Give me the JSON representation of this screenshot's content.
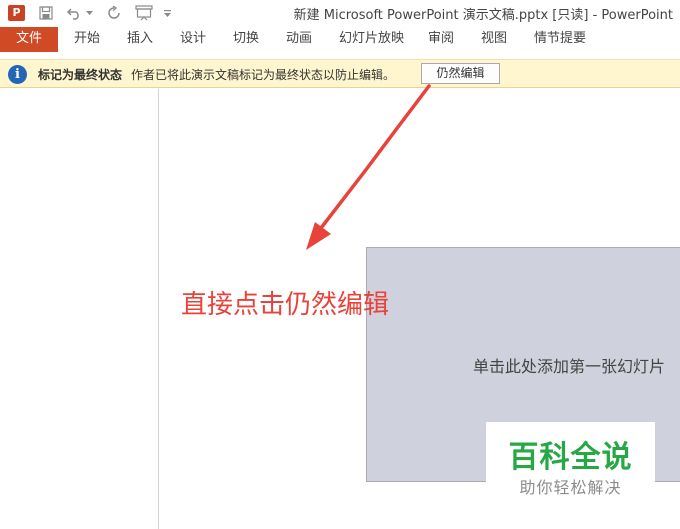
{
  "app": {
    "icon_letter": "P",
    "window_title": "新建 Microsoft PowerPoint 演示文稿.pptx [只读] - PowerPoint"
  },
  "quick_access": [
    "save-icon",
    "undo-icon",
    "redo-icon",
    "slideshow-icon",
    "customize-chevron-icon"
  ],
  "ribbon": {
    "tabs": [
      {
        "label": "文件"
      },
      {
        "label": "开始"
      },
      {
        "label": "插入"
      },
      {
        "label": "设计"
      },
      {
        "label": "切换"
      },
      {
        "label": "动画"
      },
      {
        "label": "幻灯片放映"
      },
      {
        "label": "审阅"
      },
      {
        "label": "视图"
      },
      {
        "label": "情节提要"
      }
    ]
  },
  "message_bar": {
    "icon": "info-icon",
    "title": "标记为最终状态",
    "text": "作者已将此演示文稿标记为最终状态以防止编辑。",
    "button_label": "仍然编辑"
  },
  "slide": {
    "placeholder": "单击此处添加第一张幻灯片"
  },
  "annotation": {
    "text": "直接点击仍然编辑",
    "color": "#e8433a"
  },
  "watermark": {
    "main": "百科全说",
    "sub": "助你轻松解决",
    "color": "#27a844"
  },
  "colors": {
    "file_tab": "#d04a26",
    "message_bar": "#fff5ce",
    "slide": "#cfd2dc",
    "info": "#2266b5"
  }
}
